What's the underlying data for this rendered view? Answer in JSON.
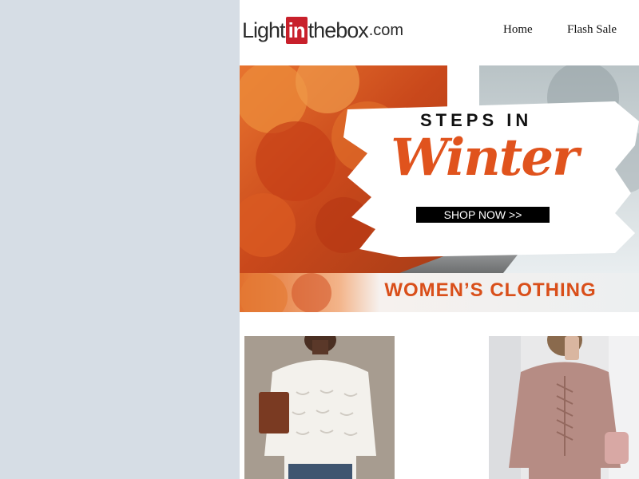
{
  "header": {
    "logo_light": "Light",
    "logo_in": "in",
    "logo_thebox": "thebox",
    "logo_com": ".com",
    "nav": {
      "home": "Home",
      "flash_sale": "Flash Sale"
    }
  },
  "hero": {
    "steps_in": "STEPS IN",
    "winter": "Winter",
    "shop_now": "SHOP NOW >>",
    "category": "WOMEN’S CLOTHING"
  },
  "colors": {
    "background": "#d6dde5",
    "logo_red": "#c8202b",
    "accent_orange": "#e0531d",
    "autumn_orange": "#d9632a"
  },
  "icons": [
    "logo-badge"
  ]
}
